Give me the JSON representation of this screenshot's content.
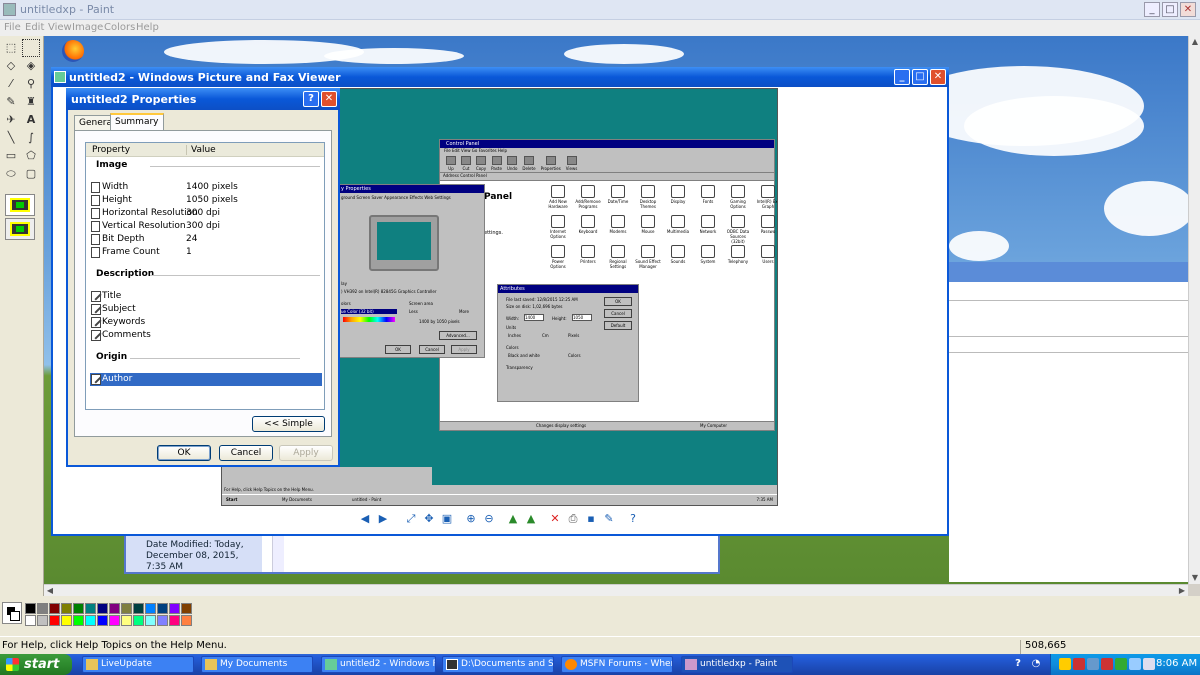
{
  "paint": {
    "title": "untitledxp - Paint",
    "menu": [
      "File",
      "Edit",
      "View",
      "Image",
      "Colors",
      "Help"
    ],
    "status_text": "For Help, click Help Topics on the Help Menu.",
    "coords": "508,665",
    "palette_colors": [
      "#000000",
      "#808080",
      "#800000",
      "#808000",
      "#008000",
      "#008080",
      "#000080",
      "#800080",
      "#808040",
      "#004040",
      "#0080ff",
      "#004080",
      "#8000ff",
      "#804000",
      "#ffffff",
      "#c0c0c0",
      "#ff0000",
      "#ffff00",
      "#00ff00",
      "#00ffff",
      "#0000ff",
      "#ff00ff",
      "#ffff80",
      "#00ff80",
      "#80ffff",
      "#8080ff",
      "#ff0080",
      "#ff8040"
    ]
  },
  "viewer": {
    "title": "untitled2 - Windows Picture and Fax Viewer"
  },
  "properties": {
    "title": "untitled2 Properties",
    "tabs": [
      "General",
      "Summary"
    ],
    "active_tab": "Summary",
    "columns": {
      "property": "Property",
      "value": "Value"
    },
    "groups": {
      "image": {
        "label": "Image",
        "rows": [
          {
            "label": "Width",
            "value": "1400 pixels"
          },
          {
            "label": "Height",
            "value": "1050 pixels"
          },
          {
            "label": "Horizontal Resolution",
            "value": "300 dpi"
          },
          {
            "label": "Vertical Resolution",
            "value": "300 dpi"
          },
          {
            "label": "Bit Depth",
            "value": "24"
          },
          {
            "label": "Frame Count",
            "value": "1"
          }
        ]
      },
      "description": {
        "label": "Description",
        "rows": [
          {
            "label": "Title"
          },
          {
            "label": "Subject"
          },
          {
            "label": "Keywords"
          },
          {
            "label": "Comments"
          }
        ]
      },
      "origin": {
        "label": "Origin",
        "rows": [
          {
            "label": "Author"
          }
        ]
      }
    },
    "simple_label": "<< Simple",
    "ok_label": "OK",
    "cancel_label": "Cancel",
    "apply_label": "Apply"
  },
  "details": {
    "date_modified": "Date Modified: Today, December 08, 2015, 7:35 AM"
  },
  "embedded_shot": {
    "cp_title": "Control Panel",
    "cp_heading": "Panel",
    "cp_settings": "ettings.",
    "cp_address_label": "Address",
    "cp_address_value": "Control Panel",
    "cp_tools": [
      "Up",
      "Cut",
      "Copy",
      "Paste",
      "Undo",
      "Delete",
      "Properties",
      "Views"
    ],
    "cp_icons": [
      "Add New Hardware",
      "Add/Remove Programs",
      "Date/Time",
      "Desktop Themes",
      "Display",
      "Fonts",
      "Gaming Options",
      "Intel(R) Ext Graph",
      "Internet Options",
      "Keyboard",
      "Modems",
      "Mouse",
      "Multimedia",
      "Network",
      "ODBC Data Sources (32bit)",
      "Passwo",
      "Power Options",
      "Printers",
      "Regional Settings",
      "Sound Effect Manager",
      "Sounds",
      "System",
      "Telephony",
      "Users"
    ],
    "cp_status_left": "Changes display settings",
    "cp_status_right": "My Computer",
    "dp_title": "y Properties",
    "dp_tabs": "ground  Screen Saver  Appearance  Effects  Web  Settings",
    "dp_display": "lay",
    "dp_adapter": ") VH392 on Intel(R) 82845G Graphics Controller",
    "dp_colors": "olors",
    "dp_colors_value": "ue Color (32 bit)",
    "dp_screen_area": "Screen area",
    "dp_less": "Less",
    "dp_more": "More",
    "dp_resolution": "1400 by 1050 pixels",
    "dp_advanced": "Advanced...",
    "dp_ok": "OK",
    "dp_cancel": "Cancel",
    "dp_apply": "Apply",
    "attr_title": "Attributes",
    "attr_file_last_saved": "File last saved:  12/8/2015 12:25 AM",
    "attr_size_on_disk": "Size on disk:    1,02,696 bytes",
    "attr_width_label": "Width:",
    "attr_width_value": "1400",
    "attr_height_label": "Height:",
    "attr_height_value": "1050",
    "attr_units": "Units",
    "attr_inches": "Inches",
    "attr_cm": "Cm",
    "attr_pixels": "Pixels",
    "attr_colors": "Colors",
    "attr_bw": "Black and white",
    "attr_colors_opt": "Colors",
    "attr_transparency": "Transparency",
    "attr_ok": "OK",
    "attr_cancel": "Cancel",
    "attr_default": "Default",
    "paint_status": "For Help, click Help Topics on the Help Menu.",
    "taskbar_start": "Start",
    "taskbar_docs": "My Documents",
    "taskbar_paint": "untitled - Paint",
    "taskbar_time": "7:35 AM"
  },
  "taskbar": {
    "start": "start",
    "items": [
      {
        "label": "LiveUpdate"
      },
      {
        "label": "My Documents"
      },
      {
        "label": "untitled2 - Windows P..."
      },
      {
        "label": "D:\\Documents and Se..."
      },
      {
        "label": "MSFN Forums - Wher..."
      },
      {
        "label": "untitledxp - Paint"
      }
    ],
    "clock": "8:06 AM"
  }
}
